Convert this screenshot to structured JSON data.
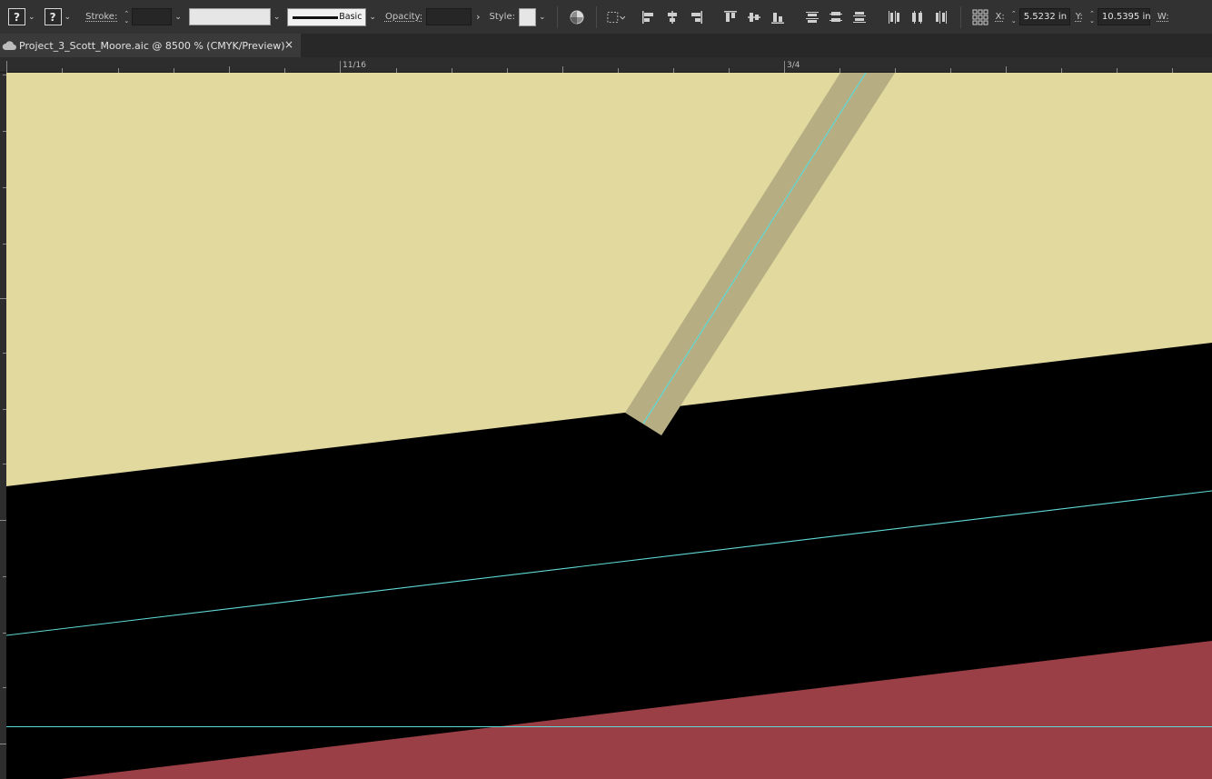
{
  "control_bar": {
    "fill_symbol": "?",
    "stroke_symbol": "?",
    "stroke_label": "Stroke:",
    "stroke_weight": "",
    "brush_definition": "Basic",
    "opacity_label": "Opacity:",
    "opacity_value": "",
    "style_label": "Style:",
    "x_label": "X:",
    "x_value": "5.5232 in",
    "y_label": "Y:",
    "y_value": "10.5395 in",
    "w_label": "W:"
  },
  "document_tab": {
    "title": "Project_3_Scott_Moore.aic @ 8500 % (CMYK/Preview)",
    "close_symbol": "×"
  },
  "ruler": {
    "labels": [
      "11/16",
      "3/4"
    ]
  },
  "colors": {
    "cream_fill": "#e2d99f",
    "black_fill": "#000000",
    "red_fill": "#9b3f47",
    "stroke_band": "#b6ae82",
    "guide_cyan": "#5fd9d7"
  }
}
